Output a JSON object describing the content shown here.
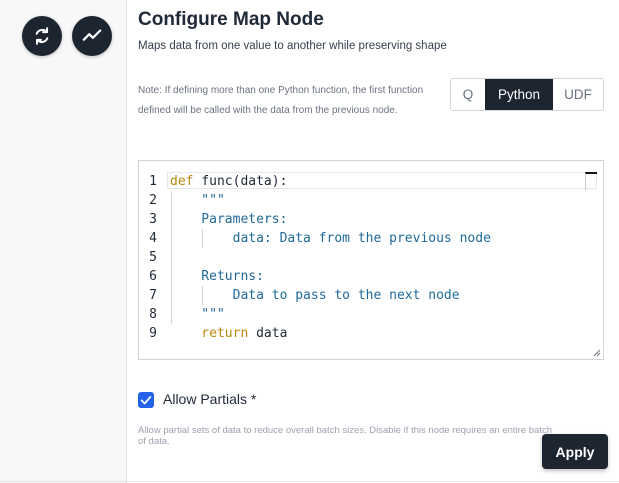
{
  "left_panel": {
    "buttons": [
      {
        "icon": "refresh-icon"
      },
      {
        "icon": "trend-line-icon"
      }
    ]
  },
  "header": {
    "title": "Configure Map Node",
    "subtitle": "Maps data from one value to another while preserving shape"
  },
  "note": "Note: If defining more than one Python function, the first function defined will be called with the data from the previous node.",
  "language_toggle": {
    "options": [
      "Q",
      "Python",
      "UDF"
    ],
    "selected": "Python"
  },
  "editor": {
    "lines": [
      {
        "num": "1",
        "tokens": [
          {
            "t": "def ",
            "c": "kw"
          },
          {
            "t": "func(data):",
            "c": "plain"
          }
        ]
      },
      {
        "num": "2",
        "tokens": [
          {
            "t": "    \"\"\"",
            "c": "str"
          }
        ]
      },
      {
        "num": "3",
        "tokens": [
          {
            "t": "    Parameters:",
            "c": "str"
          }
        ]
      },
      {
        "num": "4",
        "tokens": [
          {
            "t": "        data: Data from the previous node",
            "c": "str"
          }
        ]
      },
      {
        "num": "5",
        "tokens": [
          {
            "t": "",
            "c": "str"
          }
        ]
      },
      {
        "num": "6",
        "tokens": [
          {
            "t": "    Returns:",
            "c": "str"
          }
        ]
      },
      {
        "num": "7",
        "tokens": [
          {
            "t": "        Data to pass to the next node",
            "c": "str"
          }
        ]
      },
      {
        "num": "8",
        "tokens": [
          {
            "t": "    \"\"\"",
            "c": "str"
          }
        ]
      },
      {
        "num": "9",
        "tokens": [
          {
            "t": "    return ",
            "c": "kw"
          },
          {
            "t": "data",
            "c": "plain"
          }
        ]
      }
    ]
  },
  "allow_partials": {
    "label": "Allow Partials *",
    "checked": true,
    "help": "Allow partial sets of data to reduce overall batch sizes. Disable if this node requires an entire batch of data."
  },
  "apply_label": "Apply",
  "colors": {
    "dark": "#1c2530",
    "accent": "#2563eb",
    "keyword": "#b8860b",
    "string": "#1f6a9a"
  }
}
